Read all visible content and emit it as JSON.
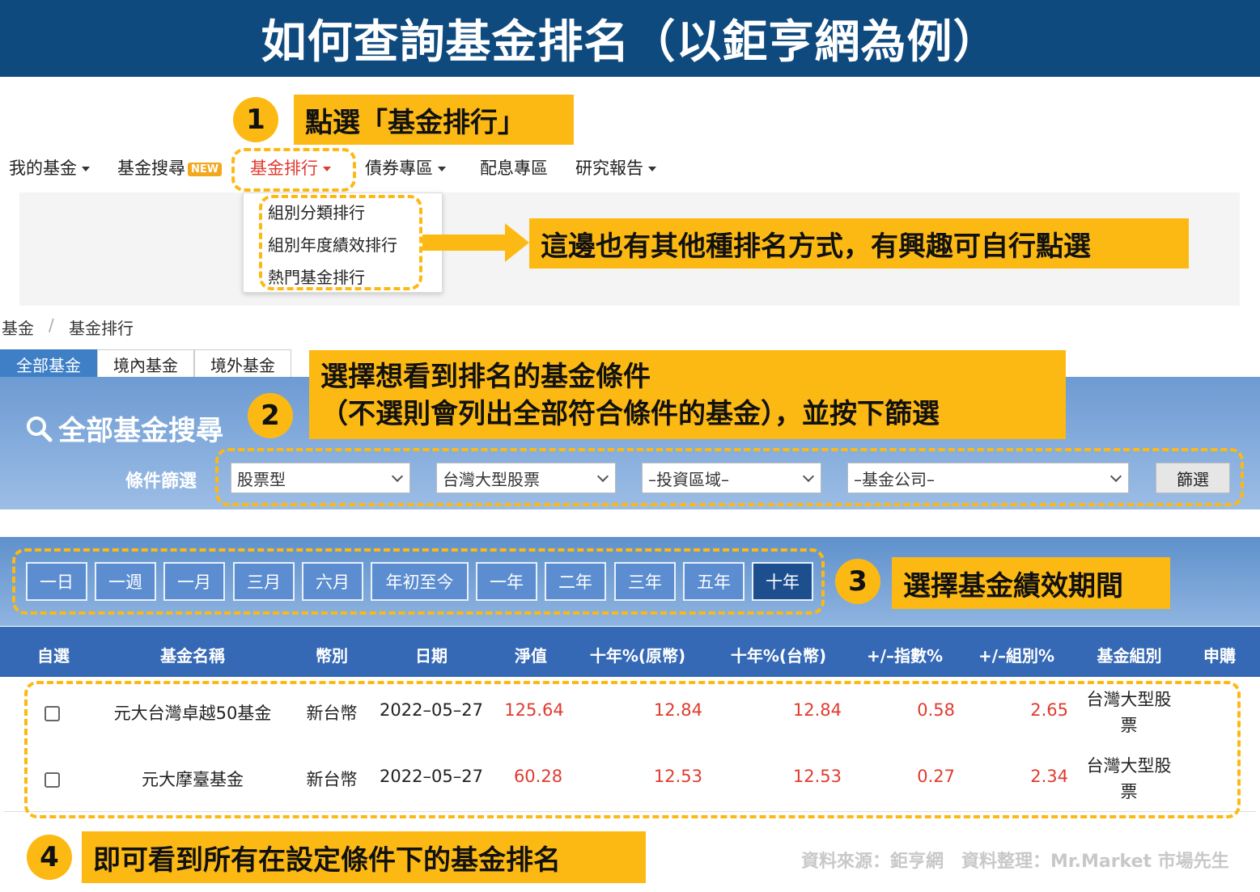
{
  "title": "如何查詢基金排名（以鉅亨網為例）",
  "steps": {
    "s1": {
      "num": "1",
      "text": "點選「基金排行」"
    },
    "s2": {
      "num": "2",
      "line1": "選擇想看到排名的基金條件",
      "line2": "（不選則會列出全部符合條件的基金），並按下篩選"
    },
    "s3": {
      "num": "3",
      "text": "選擇基金績效期間"
    },
    "s4": {
      "num": "4",
      "text": "即可看到所有在設定條件下的基金排名"
    },
    "extra": "這邊也有其他種排名方式，有興趣可自行點選"
  },
  "nav": {
    "my_funds": "我的基金",
    "fund_search": "基金搜尋",
    "new_badge": "NEW",
    "fund_ranking": "基金排行",
    "bonds": "債券專區",
    "dividend": "配息專區",
    "research": "研究報告"
  },
  "dropdown": [
    "組別分類排行",
    "組別年度績效排行",
    "熱門基金排行"
  ],
  "breadcrumb": {
    "root": "基金",
    "sep": "/",
    "current": "基金排行"
  },
  "tabs": [
    "全部基金",
    "境內基金",
    "境外基金"
  ],
  "search": {
    "title": "全部基金搜尋",
    "filter_label": "條件篩選",
    "selects": [
      "股票型",
      "台灣大型股票",
      "–投資區域–",
      "–基金公司–"
    ],
    "button": "篩選"
  },
  "periods": [
    "一日",
    "一週",
    "一月",
    "三月",
    "六月",
    "年初至今",
    "一年",
    "二年",
    "三年",
    "五年",
    "十年"
  ],
  "active_period": "十年",
  "table": {
    "headers": [
      "自選",
      "基金名稱",
      "幣別",
      "日期",
      "淨值",
      "十年%(原幣)",
      "十年%(台幣)",
      "+/–指數%",
      "+/–組別%",
      "基金組別",
      "申購"
    ],
    "rows": [
      {
        "name": "元大台灣卓越50基金",
        "currency": "新台幣",
        "date": "2022–05–27",
        "nav": "125.64",
        "ret_orig": "12.84",
        "ret_twd": "12.84",
        "vs_index": "0.58",
        "vs_group": "2.65",
        "group_l1": "台灣大型股",
        "group_l2": "票"
      },
      {
        "name": "元大摩臺基金",
        "currency": "新台幣",
        "date": "2022–05–27",
        "nav": "60.28",
        "ret_orig": "12.53",
        "ret_twd": "12.53",
        "vs_index": "0.27",
        "vs_group": "2.34",
        "group_l1": "台灣大型股",
        "group_l2": "票"
      }
    ]
  },
  "source": "資料來源：鉅亨網　資料整理：Mr.Market 市場先生",
  "colors": {
    "banner": "#0f4a7e",
    "highlight": "#fdb913",
    "accent_red": "#e03b2f",
    "table_head": "#3569b5"
  }
}
